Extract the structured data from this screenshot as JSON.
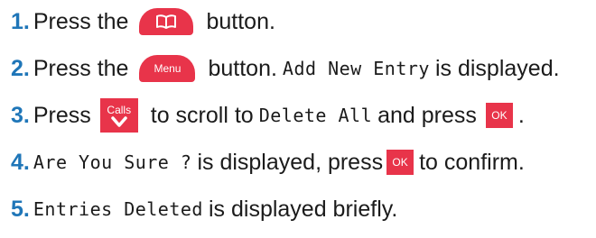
{
  "steps": [
    {
      "number": "1.",
      "parts": [
        "Press the",
        "button."
      ],
      "icons": {
        "book": "phonebook-icon"
      }
    },
    {
      "number": "2.",
      "parts": [
        "Press the",
        "button.",
        "is displayed."
      ],
      "buttons": {
        "menu": "Menu"
      },
      "screen": {
        "add_new_entry": "Add New Entry"
      }
    },
    {
      "number": "3.",
      "parts": [
        "Press",
        "to scroll to",
        "and press",
        "."
      ],
      "buttons": {
        "calls": "Calls",
        "ok": "OK"
      },
      "icons": {
        "calls_arrow": "chevron-down-icon"
      },
      "screen": {
        "delete_all": "Delete All"
      }
    },
    {
      "number": "4.",
      "parts": [
        "is displayed, press",
        "to confirm."
      ],
      "buttons": {
        "ok": "OK"
      },
      "screen": {
        "are_you_sure": "Are You Sure ?"
      }
    },
    {
      "number": "5.",
      "parts": [
        "is displayed briefly."
      ],
      "screen": {
        "entries_deleted": "Entries Deleted"
      }
    }
  ],
  "colors": {
    "accent_button": "#e8344a",
    "step_number": "#1f76b8",
    "text": "#1b1b1b"
  }
}
